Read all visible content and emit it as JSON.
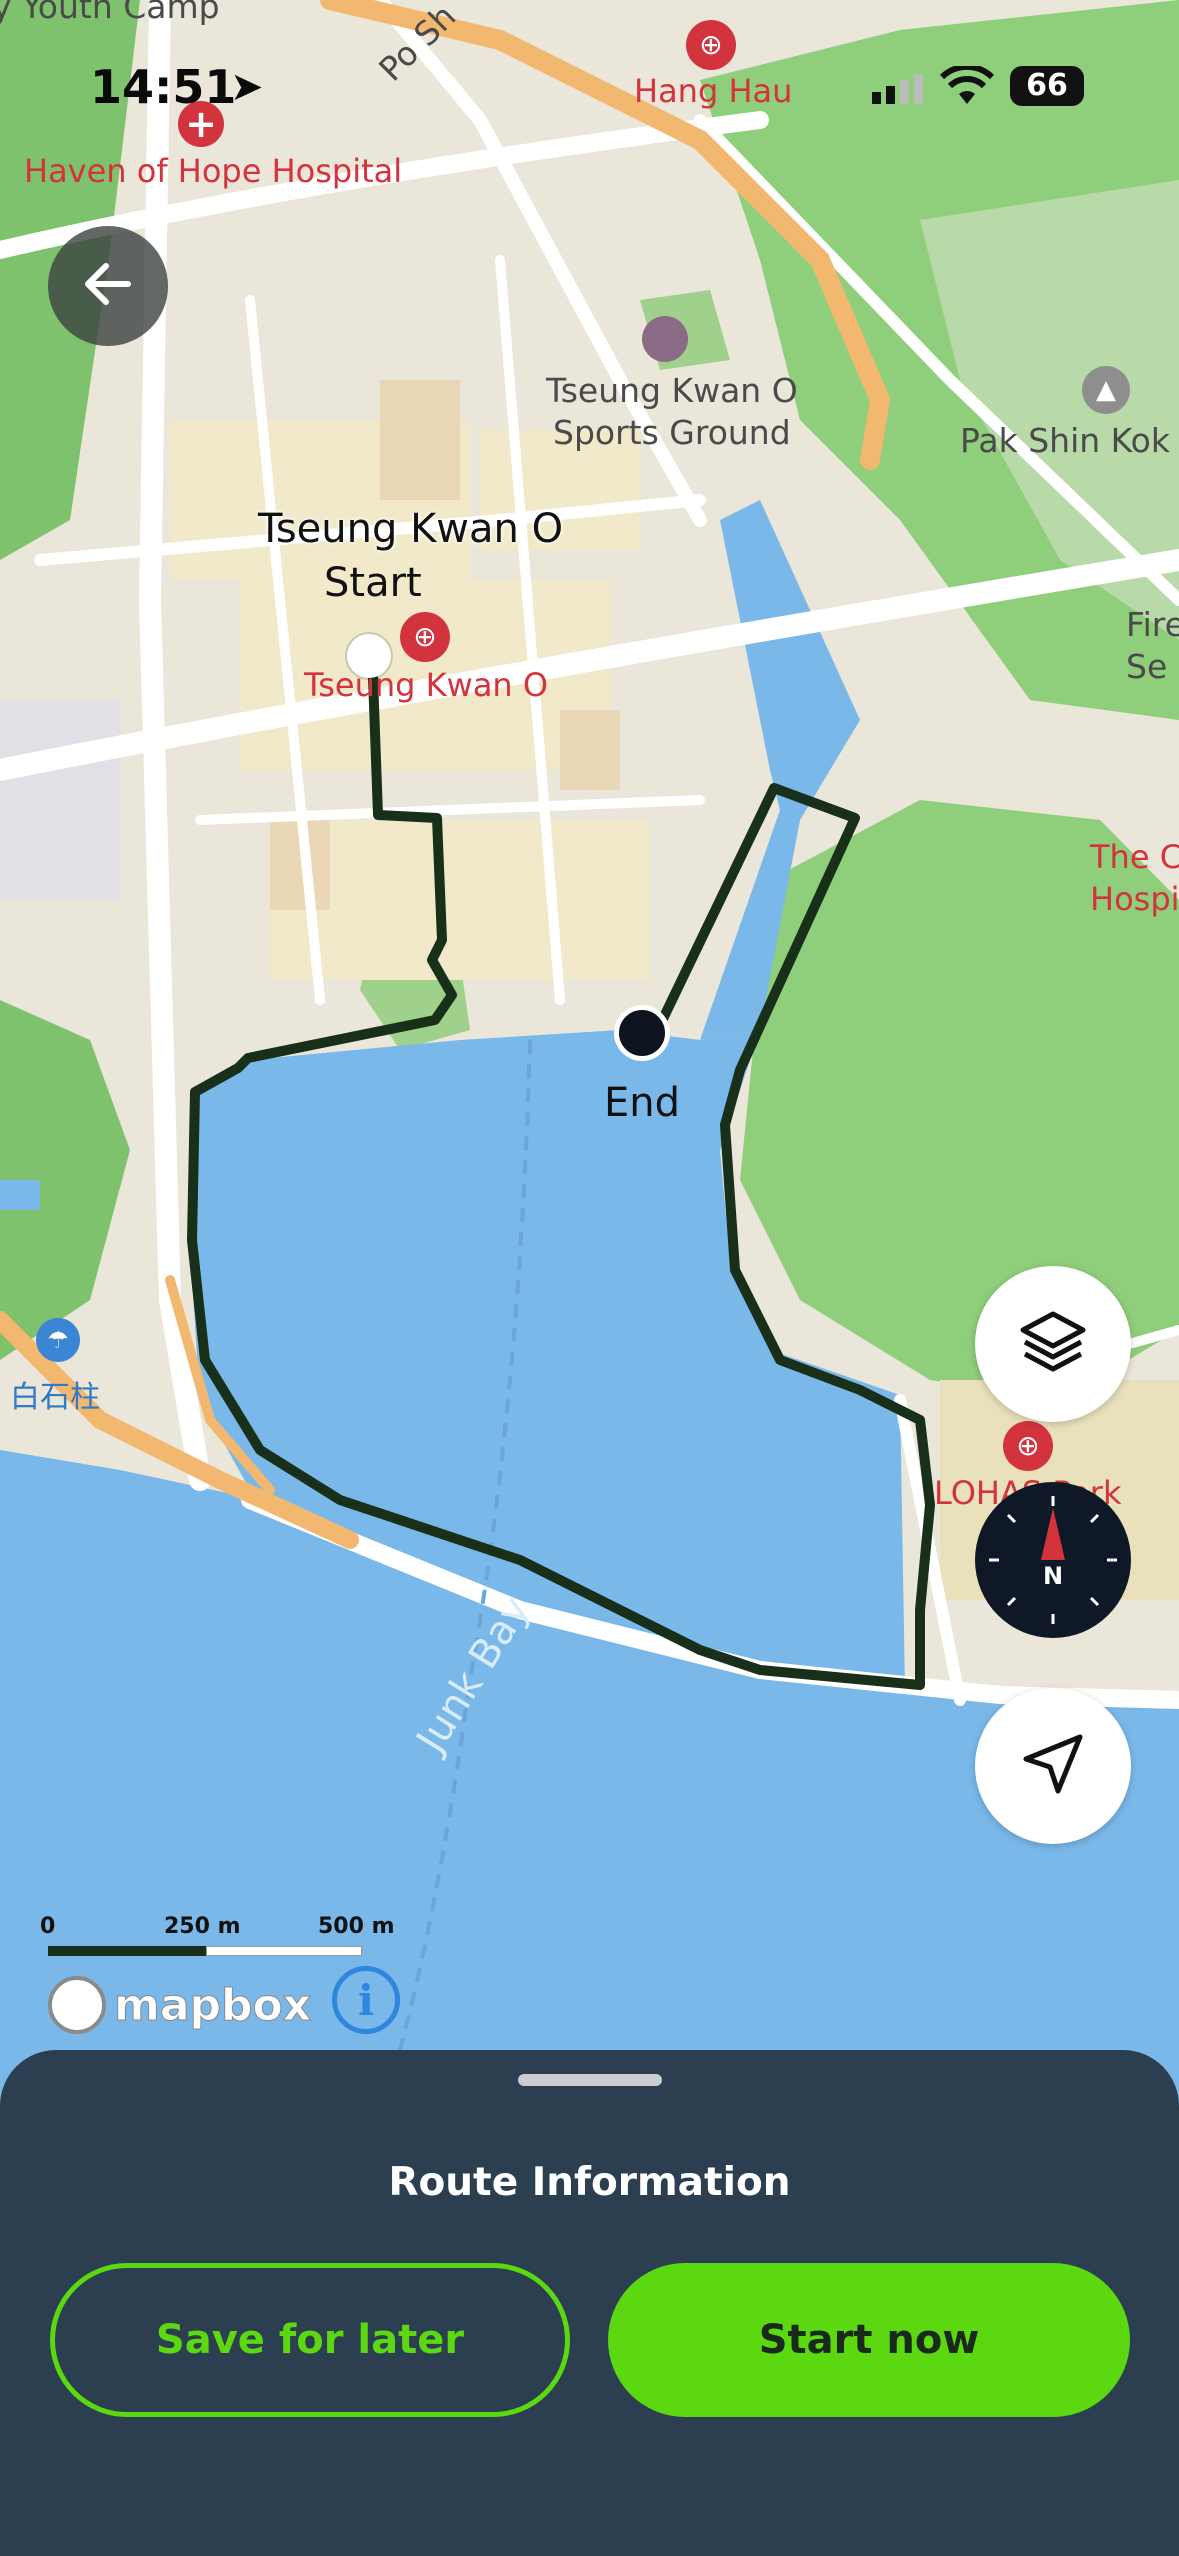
{
  "status_bar": {
    "time": "14:51",
    "battery": "66"
  },
  "map": {
    "labels": {
      "youth_camp": "y Youth Camp",
      "po_shun": "Po Sh",
      "hang_hau": "Hang Hau",
      "haven_of_hope": "Haven of Hope Hospital",
      "sports_ground": "Tseung Kwan O\nSports Ground",
      "pak_shin_kok": "Pak Shin Kok S",
      "route_start_name": "Tseung Kwan O",
      "route_start_tag": "Start",
      "tko_station": "Tseung Kwan O",
      "route_end_tag": "End",
      "fire_station": "Fire\nSe",
      "hospital": "The C\nHospi",
      "pak_shek_kok": "白石柱",
      "lohas_park": "LOHAS Park",
      "junk_bay": "Junk Bay"
    },
    "scale": {
      "ticks": [
        "0",
        "250 m",
        "500 m"
      ]
    },
    "attribution": "mapbox",
    "controls": {
      "back_icon": "arrow-left-icon",
      "layers_icon": "layers-icon",
      "compass_icon": "compass-icon",
      "compass_letter": "N",
      "locate_icon": "navigation-arrow-icon"
    },
    "colors": {
      "route": "#18301a",
      "water": "#7ab8ea",
      "accent": "#5bd80f"
    }
  },
  "sheet": {
    "title": "Route Information",
    "save_label": "Save for later",
    "start_label": "Start now"
  }
}
